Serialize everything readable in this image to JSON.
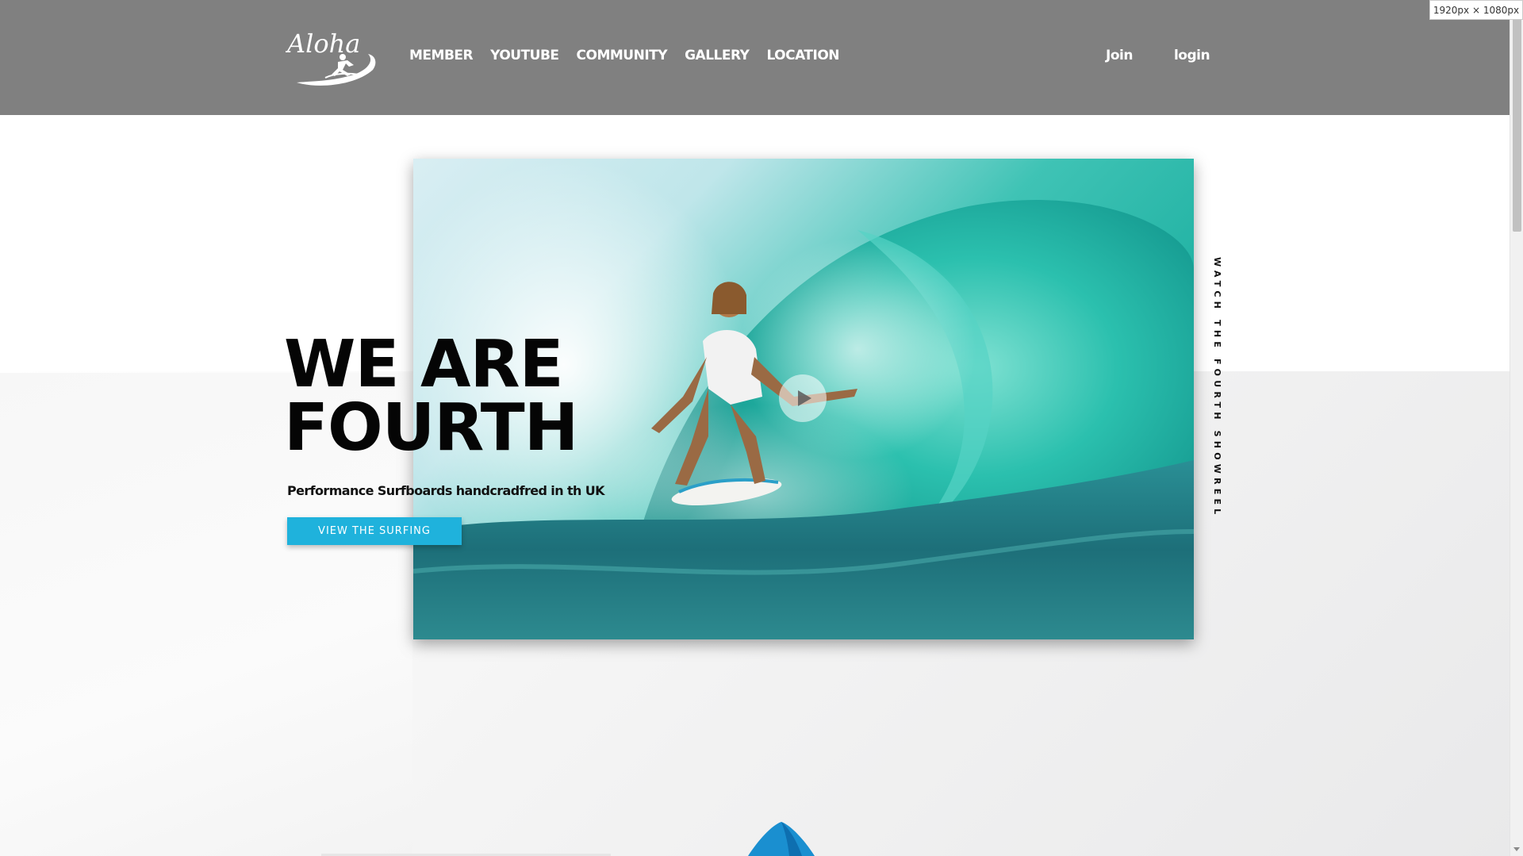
{
  "header": {
    "logo_text": "Aloha",
    "nav": [
      {
        "label": "MEMBER"
      },
      {
        "label": "YOUTUBE"
      },
      {
        "label": "COMMUNITY"
      },
      {
        "label": "GALLERY"
      },
      {
        "label": "LOCATION"
      }
    ],
    "join_label": "Join",
    "login_label": "login"
  },
  "hero": {
    "headline_line1": "WE ARE",
    "headline_line2": "FOURTH",
    "subtitle": "Performance Surfboards handcradfred in th UK",
    "cta_label": "VIEW THE SURFING",
    "side_label": "WATCH THE FOURTH SHOWREEL",
    "video_icon": "play-icon"
  },
  "viewport_badge": "1920px × 1080px",
  "colors": {
    "header_bg": "#808080",
    "accent": "#1fb2dc",
    "text_dark": "#050505"
  }
}
